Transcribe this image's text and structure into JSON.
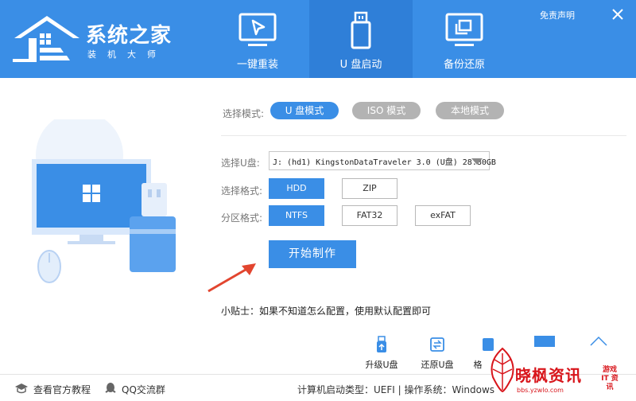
{
  "header": {
    "logo_title": "系统之家",
    "logo_sub": "装机大师",
    "tabs": [
      {
        "label": "一键重装",
        "icon": "cursor-monitor-icon"
      },
      {
        "label": "U 盘启动",
        "icon": "usb-drive-icon"
      },
      {
        "label": "备份还原",
        "icon": "backup-restore-icon"
      }
    ],
    "active_tab": 1,
    "disclaimer": "免责声明",
    "close_icon": "close-icon"
  },
  "mode": {
    "label": "选择模式:",
    "options": [
      "U 盘模式",
      "ISO 模式",
      "本地模式"
    ],
    "selected": 0
  },
  "usb": {
    "label": "选择U盘:",
    "value": "J: (hd1) KingstonDataTraveler 3.0 (U盘) 28.80GB"
  },
  "format": {
    "label": "选择格式:",
    "options": [
      "HDD",
      "ZIP"
    ],
    "selected": 0
  },
  "partition": {
    "label": "分区格式:",
    "options": [
      "NTFS",
      "FAT32",
      "exFAT"
    ],
    "selected": 0
  },
  "start_button": "开始制作",
  "tip": "小贴士：如果不知道怎么配置，使用默认配置即可",
  "tools": [
    {
      "label": "升级U盘",
      "icon": "usb-upgrade-icon"
    },
    {
      "label": "还原U盘",
      "icon": "restore-icon"
    },
    {
      "label": "格",
      "icon": "format-icon"
    }
  ],
  "footer": {
    "official_tutorial": "查看官方教程",
    "qq_group": "QQ交流群",
    "sysinfo": "计算机启动类型：UEFI | 操作系统：Windows"
  },
  "watermark": {
    "main": "晓枫资讯",
    "side": "游戏 IT 资讯",
    "url": "bbs.yzwlo.com"
  },
  "colors": {
    "header": "#3a8ee6",
    "active_tab": "#2f7fd8",
    "accent": "#3a8ee6",
    "inactive_pill": "#b3b3b3",
    "arrow": "#e2452f",
    "watermark": "#d8151b"
  }
}
